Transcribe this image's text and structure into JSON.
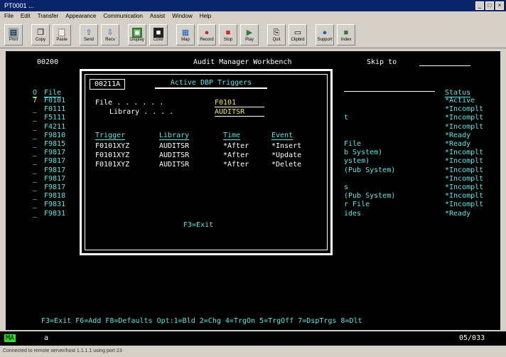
{
  "window": {
    "title": "PT0001 ...",
    "controls": [
      "_",
      "□",
      "×"
    ]
  },
  "menu": [
    "File",
    "Edit",
    "Transfer",
    "Appearance",
    "Communication",
    "Assist",
    "Window",
    "Help"
  ],
  "toolbar": [
    {
      "icon": "print-icon",
      "label": "Print"
    },
    {
      "icon": "copy-icon",
      "label": "Copy"
    },
    {
      "icon": "paste-icon",
      "label": "Paste"
    },
    {
      "icon": "send-icon",
      "label": "Send"
    },
    {
      "icon": "recv-icon",
      "label": "Recv"
    },
    {
      "icon": "display-icon",
      "label": "Display"
    },
    {
      "icon": "color-icon",
      "label": "Color"
    },
    {
      "icon": "map-icon",
      "label": "Map"
    },
    {
      "icon": "record-icon",
      "label": "Record"
    },
    {
      "icon": "stop-icon",
      "label": "Stop"
    },
    {
      "icon": "play-icon",
      "label": "Play"
    },
    {
      "icon": "quit-icon",
      "label": "Quit"
    },
    {
      "icon": "clipbrd-icon",
      "label": "Clipbrd"
    },
    {
      "icon": "support-icon",
      "label": "Support"
    },
    {
      "icon": "index-icon",
      "label": "Index"
    }
  ],
  "screen": {
    "code": "00200",
    "title": "Audit Manager Workbench",
    "skip_to_label": "Skip to",
    "opt_header": "O",
    "file_header": "File",
    "status_header": "Status",
    "rows": [
      {
        "opt": "7",
        "file": "F0101",
        "status": "*Active"
      },
      {
        "opt": "_",
        "file": "F0111",
        "status": "*Incomplt"
      },
      {
        "opt": "_",
        "file": "F5111",
        "status": "*Incomplt"
      },
      {
        "opt": "_",
        "file": "F4211",
        "status": "*Incomplt"
      },
      {
        "opt": "_",
        "file": "F9810",
        "status": "*Ready"
      },
      {
        "opt": "_",
        "file": "F9815",
        "status": "*Ready"
      },
      {
        "opt": "_",
        "file": "F9817",
        "status": "*Incomplt"
      },
      {
        "opt": "_",
        "file": "F9817",
        "status": "*Incomplt"
      },
      {
        "opt": "_",
        "file": "F9817",
        "status": "*Incomplt"
      },
      {
        "opt": "_",
        "file": "F9817",
        "status": "*Incomplt"
      },
      {
        "opt": "_",
        "file": "F9817",
        "status": "*Incomplt"
      },
      {
        "opt": "_",
        "file": "F9818",
        "status": "*Incomplt"
      },
      {
        "opt": "_",
        "file": "F9831",
        "status": "*Incomplt"
      },
      {
        "opt": "_",
        "file": "F9831",
        "status": "*Ready"
      }
    ],
    "desc_fragments": [
      {
        "row": 2,
        "text": "t"
      },
      {
        "row": 5,
        "text": "File"
      },
      {
        "row": 6,
        "text": "b System)"
      },
      {
        "row": 7,
        "text": "ystem)"
      },
      {
        "row": 8,
        "text": "(Pub System)"
      },
      {
        "row": 10,
        "text": "s"
      },
      {
        "row": 11,
        "text": "(Pub System)"
      },
      {
        "row": 12,
        "text": "r File"
      },
      {
        "row": 13,
        "text": "ides"
      }
    ],
    "function_keys": "F3=Exit F6=Add F8=Defaults Opt:1=Bld 2=Chg 4=TrgOn 5=TrgOff 7=DspTrgs 8=Dlt"
  },
  "popup": {
    "code": "00211A",
    "title": "Active DBP Triggers",
    "file_label": "File . . . . . .",
    "file_value": "F0101",
    "library_label": "Library . . . .",
    "library_value": "AUDITSR",
    "col_trigger": "Trigger",
    "col_library": "Library",
    "col_time": "Time",
    "col_event": "Event",
    "rows": [
      {
        "trigger": "F0101XYZ",
        "library": "AUDITSR",
        "time": "*After",
        "event": "*Insert"
      },
      {
        "trigger": "F0101XYZ",
        "library": "AUDITSR",
        "time": "*After",
        "event": "*Update"
      },
      {
        "trigger": "F0101XYZ",
        "library": "AUDITSR",
        "time": "*After",
        "event": "*Delete"
      }
    ],
    "exit_label": "F3=Exit"
  },
  "statusbar": {
    "left": "MA",
    "cursor": "a",
    "position": "05/033"
  },
  "bottom_status": "Connected to remote server/host 1.1.1.1 using port 23"
}
